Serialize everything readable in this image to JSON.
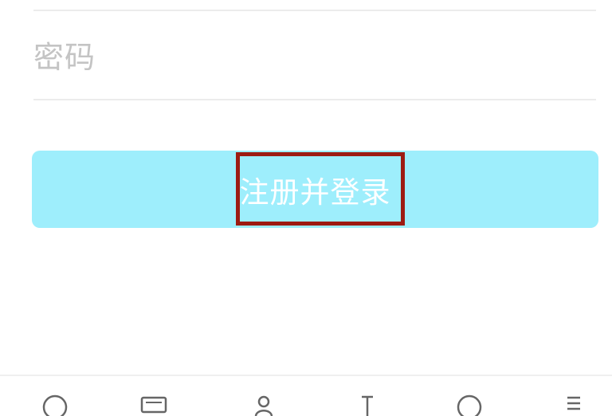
{
  "password": {
    "value": "",
    "placeholder": "密码"
  },
  "register_login_button": {
    "label": "注册并登录",
    "background_color": "#9eeefc",
    "highlight_border_color": "#9d1b12"
  },
  "bottom_bar": {
    "icons": [
      "back-icon",
      "keyboard-icon",
      "account-icon",
      "text-cursor-icon",
      "search-icon",
      "menu-icon"
    ]
  }
}
